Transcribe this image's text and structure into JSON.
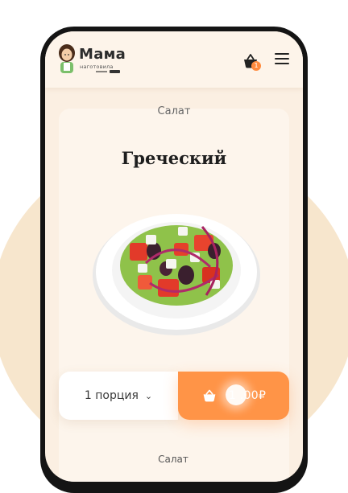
{
  "header": {
    "logo_title": "Мама",
    "logo_subtitle": "наготовила",
    "cart_count": "1",
    "cart_icon": "basket-icon",
    "menu_icon": "hamburger-menu-icon"
  },
  "product": {
    "category": "Салат",
    "title": "Греческий",
    "image_icon": "greek-salad-image"
  },
  "order": {
    "portion_label": "1 порция",
    "portion_chevron": "⌄",
    "buy_icon": "basket-icon",
    "price": "1  .00₽"
  },
  "next_item": {
    "category": "Салат"
  },
  "colors": {
    "accent": "#ff9447",
    "background": "#fbefe2",
    "blob": "#f7e6cd"
  }
}
